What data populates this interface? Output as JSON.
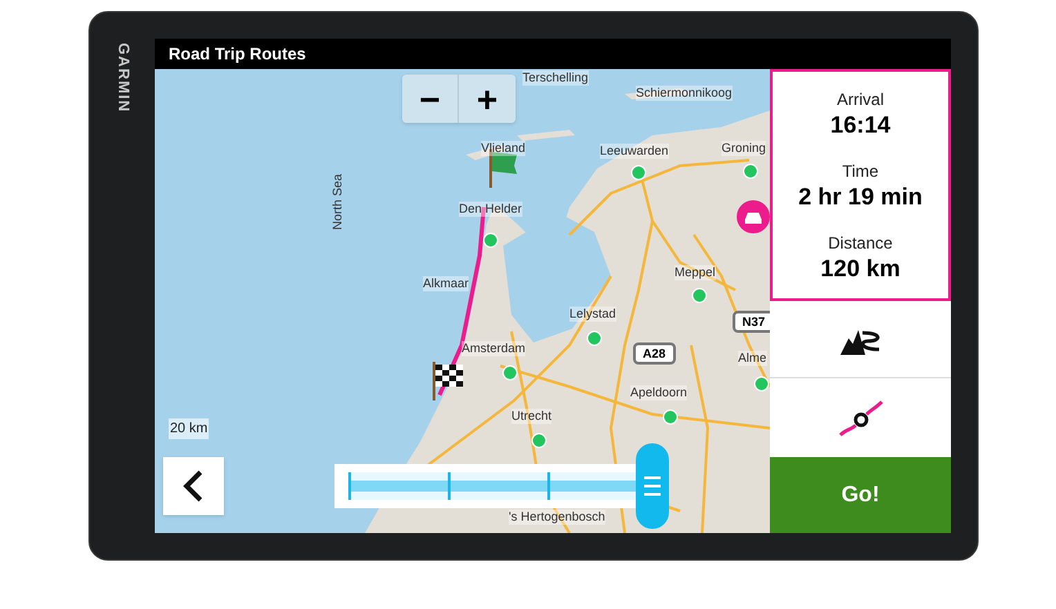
{
  "device": {
    "brand": "GARMIN"
  },
  "window": {
    "title": "Road Trip Routes"
  },
  "zoom_buttons": [
    "−",
    "+"
  ],
  "map": {
    "labels": [
      {
        "text": "Terschelling",
        "kind": "place"
      },
      {
        "text": "Schiermonnikoog",
        "kind": "place"
      },
      {
        "text": "Vlieland",
        "kind": "place"
      },
      {
        "text": "Leeuwarden",
        "kind": "place"
      },
      {
        "text": "Groning",
        "kind": "place"
      },
      {
        "text": "Den Helder",
        "kind": "place"
      },
      {
        "text": "North Sea",
        "kind": "sea"
      },
      {
        "text": "Alkmaar",
        "kind": "place"
      },
      {
        "text": "Meppel",
        "kind": "place"
      },
      {
        "text": "Lelystad",
        "kind": "place"
      },
      {
        "text": "Amsterdam",
        "kind": "place"
      },
      {
        "text": "Alme",
        "kind": "place"
      },
      {
        "text": "Apeldoorn",
        "kind": "place"
      },
      {
        "text": "Utrecht",
        "kind": "place"
      },
      {
        "text": "'s Hertogenbosch",
        "kind": "place"
      },
      {
        "text": "A28",
        "kind": "shield"
      },
      {
        "text": "N37",
        "kind": "shield"
      }
    ],
    "scale": "20 km"
  },
  "route_slider": {
    "level": 1
  },
  "trip_info": [
    {
      "label": "Arrival",
      "value": "16:14"
    },
    {
      "label": "Time",
      "value": "2 hr 19 min"
    },
    {
      "label": "Distance",
      "value": "120 km"
    }
  ],
  "go_button": "Go!"
}
